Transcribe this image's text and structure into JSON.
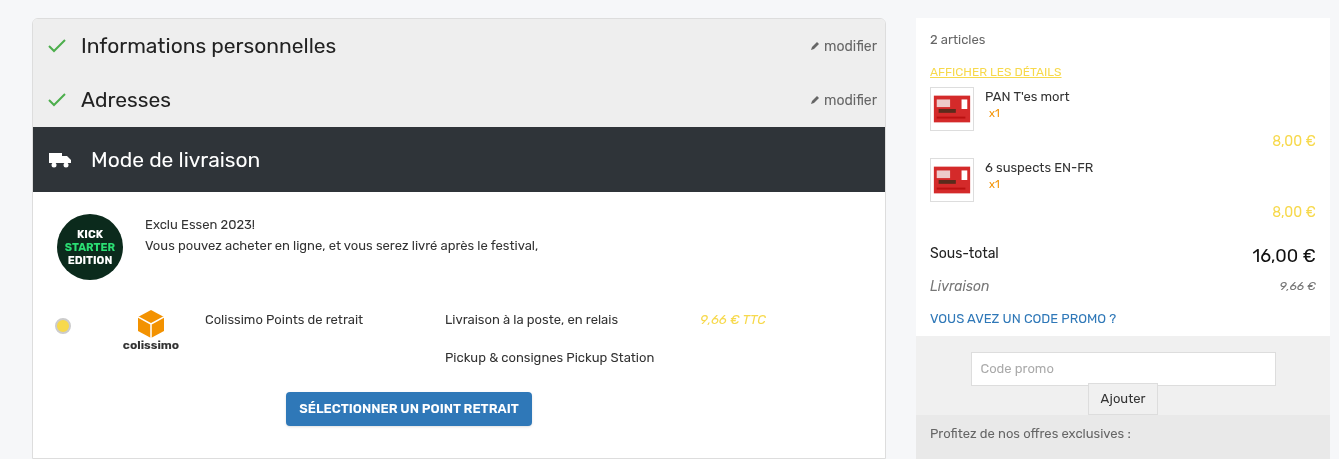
{
  "steps": [
    {
      "title": "Informations personnelles",
      "done": true,
      "edit": "modifier"
    },
    {
      "title": "Adresses",
      "done": true,
      "edit": "modifier"
    }
  ],
  "current_step": {
    "title": "Mode de livraison"
  },
  "notice": {
    "logo_lines": [
      "KICK",
      "STARTER",
      "EDITION"
    ],
    "title": "Exclu Essen 2023!",
    "text": "Vous pouvez acheter en ligne, et vous serez livré après le festival,"
  },
  "carriers": [
    {
      "selected": true,
      "logo_text": "colissimo",
      "name": "Colissimo Points de retrait",
      "delays": [
        "Livraison à la poste, en relais",
        "Pickup & consignes Pickup Station"
      ],
      "price": "9,66 € TTC"
    }
  ],
  "select_button": "SÉLECTIONNER UN POINT RETRAIT",
  "cart": {
    "count": "2 articles",
    "details_link": "AFFICHER LES DÉTAILS",
    "items": [
      {
        "kind": "picture",
        "name": "PAN T'es mort",
        "qty": "x1",
        "price": "8,00 €"
      },
      {
        "kind": "picture",
        "name": "6 suspects EN-FR",
        "qty": "x1",
        "price": "8,00 €"
      }
    ],
    "subtotal_label": "Sous-total",
    "subtotal": "16,00 €",
    "shipping_label": "Livraison",
    "shipping": "9,66 €",
    "promo_link": "VOUS AVEZ UN CODE PROMO ?",
    "promo_placeholder": "Code promo",
    "promo_button": "Ajouter",
    "offers": "Profitez de nos offres exclusives :"
  }
}
